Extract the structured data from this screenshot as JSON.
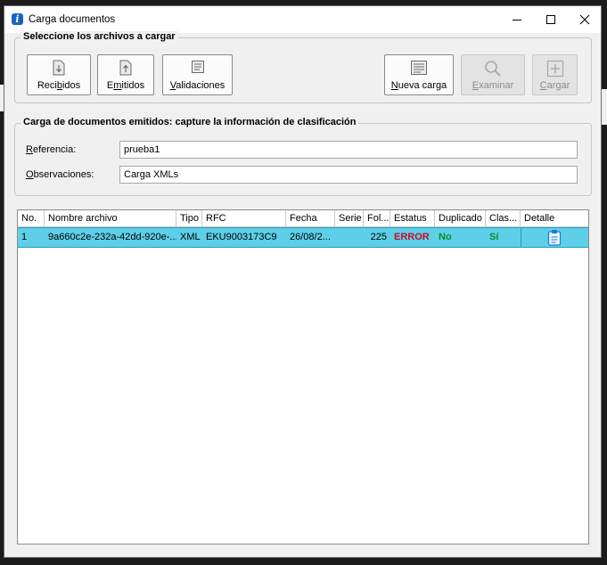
{
  "window": {
    "title": "Carga documentos",
    "app_icon_glyph": "i",
    "minimize_icon": "minimize-icon",
    "maximize_icon": "maximize-icon",
    "close_icon": "close-icon"
  },
  "files_group": {
    "title": "Seleccione los archivos a cargar",
    "buttons": {
      "recibidos": {
        "pre": "Reci",
        "u": "b",
        "post": "idos",
        "icon": "download-document-icon"
      },
      "emitidos": {
        "pre": "E",
        "u": "m",
        "post": "itidos",
        "icon": "upload-document-icon"
      },
      "validaciones": {
        "pre": "",
        "u": "V",
        "post": "alidaciones",
        "icon": "document-lines-icon"
      },
      "nueva_carga": {
        "pre": "",
        "u": "N",
        "post": "ueva carga",
        "icon": "new-list-icon"
      },
      "examinar": {
        "pre": "",
        "u": "E",
        "post": "xaminar",
        "icon": "magnifier-icon",
        "disabled": true
      },
      "cargar": {
        "pre": "",
        "u": "C",
        "post": "argar",
        "icon": "plus-box-icon",
        "disabled": true
      }
    }
  },
  "classification_group": {
    "title": "Carga de documentos emitidos: capture la información de clasificación",
    "referencia": {
      "label_u": "R",
      "label_rest": "eferencia:",
      "value": "prueba1"
    },
    "observaciones": {
      "label_u": "O",
      "label_rest": "bservaciones:",
      "value": "Carga XMLs"
    }
  },
  "table": {
    "columns": [
      "No.",
      "Nombre archivo",
      "Tipo",
      "RFC",
      "Fecha",
      "Serie",
      "Fol...",
      "Estatus",
      "Duplicado",
      "Clas...",
      "Detalle"
    ],
    "rows": [
      {
        "no": "1",
        "nombre": "9a660c2e-232a-42dd-920e-...",
        "tipo": "XML",
        "rfc": "EKU9003173C9",
        "fecha": "26/08/2...",
        "serie": "",
        "folio": "225",
        "estatus": "ERROR",
        "duplicado": "No",
        "clasificado": "Sí",
        "detalle_icon": "clipboard-icon"
      }
    ]
  },
  "colors": {
    "selection": "#5ecfe8",
    "error": "#c0102a",
    "ok": "#0e8a2e",
    "app_icon": "#1565c0"
  }
}
